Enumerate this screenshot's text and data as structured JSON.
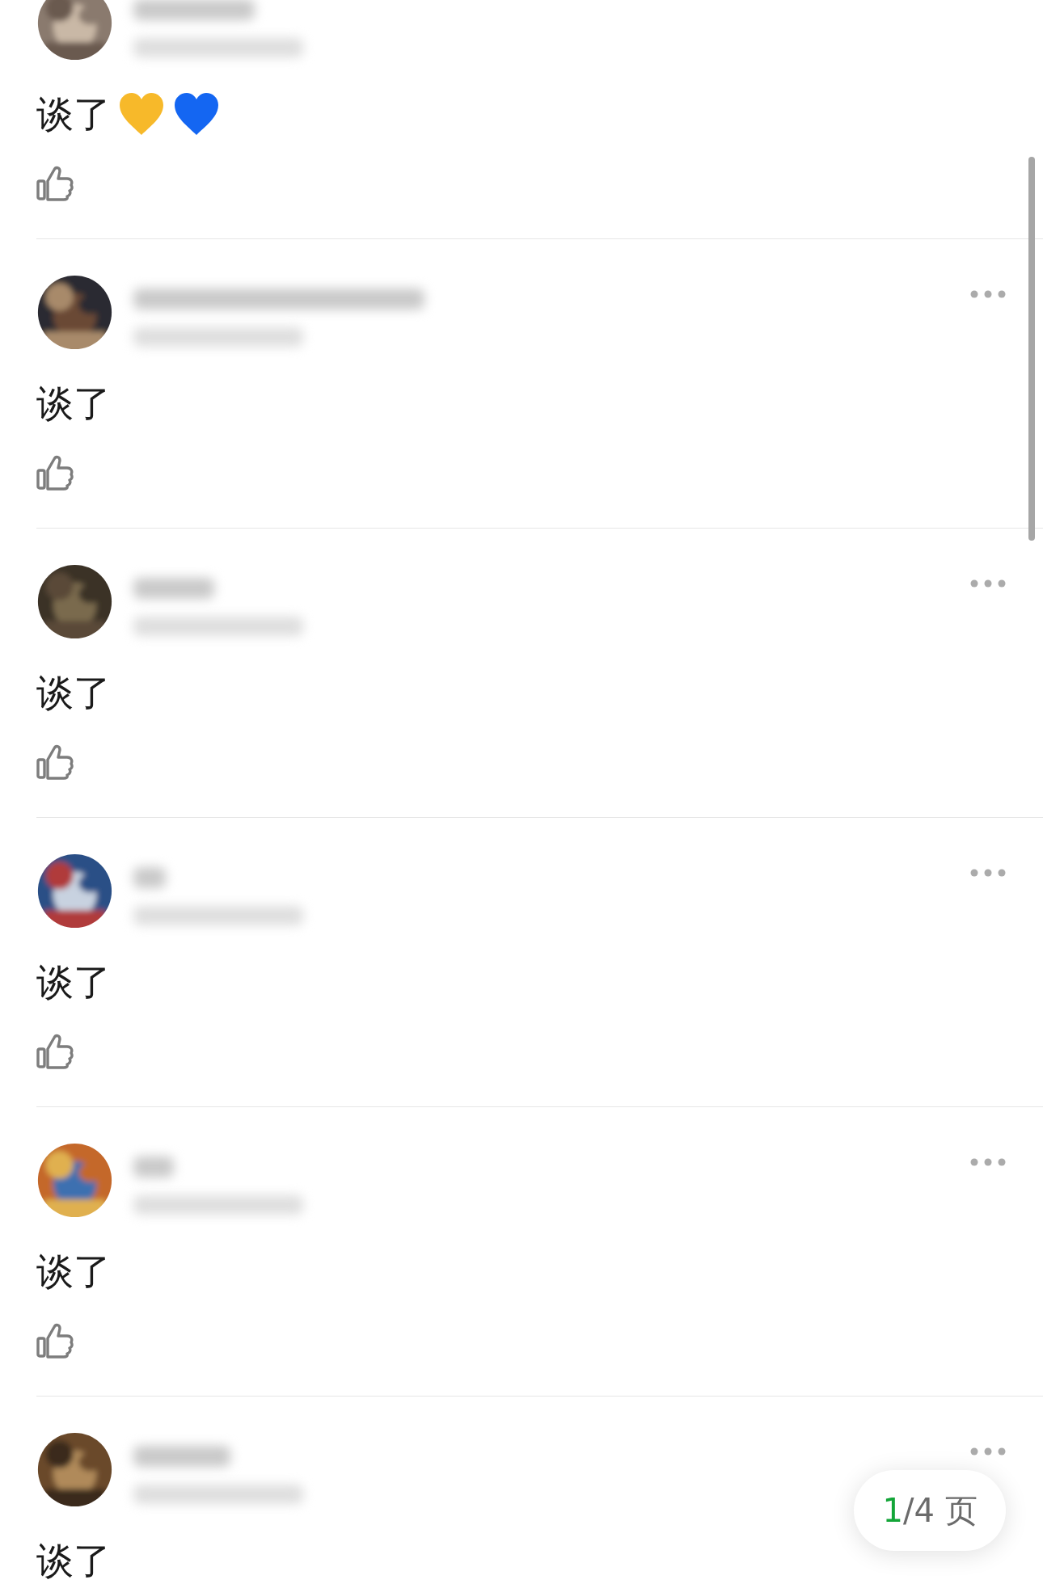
{
  "comments": [
    {
      "text": "谈了",
      "emoji": [
        {
          "color": "#f7b92a"
        },
        {
          "color": "#1466f2"
        }
      ],
      "more_menu": false,
      "liked": false
    },
    {
      "text": "谈了",
      "more_menu": true,
      "liked": false
    },
    {
      "text": "谈了",
      "more_menu": true,
      "liked": false
    },
    {
      "text": "谈了",
      "more_menu": true,
      "liked": false
    },
    {
      "text": "谈了",
      "more_menu": true,
      "liked": false
    },
    {
      "text": "谈了",
      "more_menu": true
    }
  ],
  "pager": {
    "current": "1",
    "rest": "/4 页"
  }
}
